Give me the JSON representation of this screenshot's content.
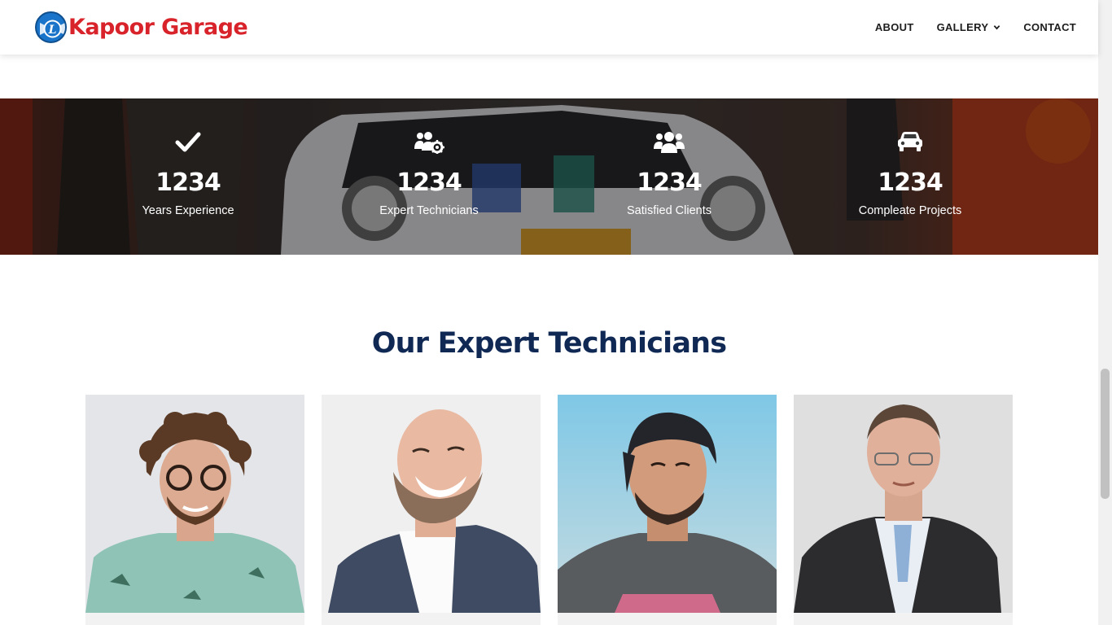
{
  "brand": {
    "name": "Kapoor Garage",
    "logo_icon": "garage-logo-icon",
    "logo_letter": "L",
    "color": "#d8232a",
    "logo_color": "#1a74c9"
  },
  "nav": {
    "items": [
      {
        "label": "ABOUT"
      },
      {
        "label": "GALLERY",
        "has_dropdown": true
      },
      {
        "label": "CONTACT"
      }
    ]
  },
  "stats": [
    {
      "icon": "check-icon",
      "number": "1234",
      "label": "Years Experience"
    },
    {
      "icon": "users-cog-icon",
      "number": "1234",
      "label": "Expert Technicians"
    },
    {
      "icon": "users-icon",
      "number": "1234",
      "label": "Satisfied Clients"
    },
    {
      "icon": "car-icon",
      "number": "1234",
      "label": "Compleate Projects"
    }
  ],
  "technicians": {
    "title": "Our Expert Technicians",
    "title_color": "#0f2854",
    "members": [
      {
        "photo": "technician-photo-1"
      },
      {
        "photo": "technician-photo-2"
      },
      {
        "photo": "technician-photo-3"
      },
      {
        "photo": "technician-photo-4"
      }
    ]
  }
}
